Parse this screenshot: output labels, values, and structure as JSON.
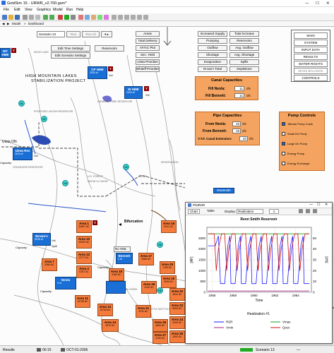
{
  "window": {
    "title": "GoldSim 15 - URWR_v2.700.gsm*",
    "min": "—",
    "max": "☐",
    "close": "✕"
  },
  "menu": [
    "File",
    "Edit",
    "View",
    "Graphics",
    "Model",
    "Run",
    "Help"
  ],
  "nav": {
    "page": "10",
    "pager": "1 / 2004",
    "back": "◀",
    "fwd": "▶",
    "model": "Model",
    "sep": "»",
    "dashboard": "Dashboard"
  },
  "controls": {
    "scenario": "Scenario 13",
    "run": "Run",
    "run_all": "Run All",
    "edit_time": "Edit Time Settings",
    "edit_scenario": "Edit Scenario Settings",
    "reservoirs": "Reservoirs"
  },
  "nav_buttons": [
    "Areas",
    "Total Delivery",
    "AF/AC Plot",
    "Sec. Yield",
    "Uinta Priorities",
    "Whiteff Priorities"
  ],
  "grid_buttons": [
    [
      "Increased Supply",
      "Total Increase"
    ],
    [
      "Pumping",
      "Reservoirs"
    ],
    [
      "Outflow",
      "Avg. Outflow"
    ],
    [
      "Shortage",
      "Avg. Shortage"
    ],
    [
      "Evaporation",
      "Spills"
    ],
    [
      "M and I Total",
      "Depletions"
    ]
  ],
  "side_menu": [
    "MAIN",
    "SYSTEM",
    "INPUT DATA",
    "RESULTS",
    "WATER RIGHTS",
    "MASS BALANCE",
    "CONTROLS"
  ],
  "canal": {
    "title": "Canal Capacities",
    "fill_neola": "Fill Neola:",
    "fill_bennett": "Fill Bennett:",
    "v1": "11",
    "v2": "11",
    "unit": "cfs"
  },
  "pipe": {
    "title": "Pipe Capacities",
    "from_neola": "From Neola:",
    "from_bennett": "From Bennett:",
    "ytf": "Y.T.F. Canal Extension:",
    "v1": "15",
    "v2": "15",
    "v3": "20",
    "unit": "cfs"
  },
  "pump": {
    "title": "Pump Controls",
    "items": [
      "Tabular Pump Costs",
      "Small Dir Pump",
      "Large Dir Pump",
      "Energy Pump",
      "Energy Exchange"
    ],
    "checked": [
      true,
      false,
      true,
      false,
      false
    ]
  },
  "map": {
    "title1": "HIGH MOUNTAIN LAKES",
    "title2": "STABILIZATION PROJECT",
    "bifurcation": "Bifurcation",
    "mapnotes": [
      "PROPOSED UINTAH RESERVOIR",
      "CEDARVIEW RESERVOIR",
      "PARADISE PARK RESERVOIR",
      "U.S. FOREST",
      "UINTAH & OURAY",
      "INDIAN",
      "RESERVATION",
      "MOON LAKE",
      "FARM CREEK",
      "LITTLE BOTTLE RESERVOIR",
      "WHITEROCKS RIVER"
    ]
  },
  "reservoirs": [
    {
      "name": "MT HME",
      "v": "",
      "sub": ""
    },
    {
      "name": "CP HME",
      "v": "Vol",
      "sub": "2034 af"
    },
    {
      "name": "W HME",
      "v": "Vol",
      "sub": "2034 af"
    },
    {
      "name": "Uinta Res",
      "v": "Vol",
      "sub": "1100 af"
    },
    {
      "name": "Brown's",
      "v": "Vol",
      "sub": "5035 af"
    },
    {
      "name": "Bennett",
      "v": "",
      "sub": "2 af"
    },
    {
      "name": "Neola",
      "v": "",
      "sub": "0 af"
    },
    {
      "name": "Montes",
      "v": "",
      "sub": ""
    }
  ],
  "areas": [
    {
      "name": "Area 1",
      "a": "12807 AC"
    },
    {
      "name": "Area 10",
      "a": "10002 AC"
    },
    {
      "name": "Area 12",
      "a": "5777 AC"
    },
    {
      "name": "Area 4",
      "a": "5787 AC"
    },
    {
      "name": "Area 7",
      "a": "2086 AC"
    },
    {
      "name": "Area 16",
      "a": "5011 AC"
    },
    {
      "name": "Area 17",
      "a": "2966 AC"
    },
    {
      "name": "Area 20",
      "a": "7150 AC"
    },
    {
      "name": "Area 15",
      "a": "4180 AC"
    },
    {
      "name": "Area 18",
      "a": "2240 AC"
    },
    {
      "name": "Area 19",
      "a": "2049 AC"
    },
    {
      "name": "Area 11",
      "a": "10736 AC"
    },
    {
      "name": "Area 13",
      "a": "10736 AC"
    },
    {
      "name": "Area 14",
      "a": "4570 AC"
    },
    {
      "name": "Area 21",
      "a": "4211 AC"
    },
    {
      "name": "Area 22",
      "a": "3811 AC"
    },
    {
      "name": "Area 23",
      "a": "5000 AC"
    },
    {
      "name": "Area 24",
      "a": "2000 AC"
    },
    {
      "name": "Area 25",
      "a": "1000 AC"
    },
    {
      "name": "Area 26",
      "a": "4800 AC"
    },
    {
      "name": "Area 27",
      "a": "3750 AC"
    }
  ],
  "nodes": [
    "N1",
    "N2",
    "N3",
    "N4",
    "N5",
    "N6"
  ],
  "labels": {
    "capacity": "Capacity:",
    "uinta_on": "Uinta ON",
    "nohml": "No HML",
    "resSmith": "ResSmith",
    "spill": "Spill"
  },
  "chart_window": {
    "title": "PlotRSR",
    "tab_chart": "Chart",
    "tab_table": "Table",
    "display_label": "Display:",
    "display_value": "Realization",
    "page": "1"
  },
  "chart_data": {
    "type": "line",
    "title": "Renn Smith Reservoir",
    "xlabel": "Time",
    "ylabel": "[AF]",
    "y2label": "[cfs]",
    "xticks": [
      "1956",
      "1958",
      "1960",
      "1962",
      "1964"
    ],
    "xlim": [
      1955.5,
      1965.5
    ],
    "ylim": [
      0,
      3000
    ],
    "yticks": [
      "0",
      "500",
      "1000",
      "1500",
      "2000",
      "2500"
    ],
    "y2lim": [
      0,
      60
    ],
    "y2ticks": [
      "0",
      "10",
      "20",
      "30",
      "40",
      "50"
    ],
    "legend_title": "Realization #1",
    "series": [
      {
        "name": "RSR",
        "color": "#1a1aff",
        "axis": "left",
        "x": [
          1955.6,
          1956.3,
          1956.6,
          1956.8,
          1957.2,
          1957.5,
          1957.7,
          1957.8,
          1958.2,
          1958.5,
          1958.7,
          1958.8,
          1959.2,
          1959.5,
          1959.7,
          1959.8,
          1960.2,
          1960.5,
          1960.7,
          1960.8,
          1961.2,
          1961.5,
          1961.7,
          1961.8,
          1962.2,
          1962.5,
          1962.7,
          1962.8,
          1963.2,
          1963.5,
          1963.7,
          1963.8,
          1964.2,
          1964.5,
          1964.7,
          1964.8,
          1965.3
        ],
        "y": [
          2150,
          2150,
          2600,
          400,
          400,
          2150,
          2600,
          400,
          400,
          2150,
          2600,
          400,
          400,
          2150,
          2600,
          400,
          400,
          2150,
          2600,
          400,
          400,
          2150,
          2600,
          400,
          400,
          2150,
          2600,
          400,
          400,
          2150,
          2600,
          400,
          400,
          2150,
          2600,
          400,
          400
        ]
      },
      {
        "name": "Vmax",
        "color": "#1a9e1a",
        "axis": "left",
        "x": [
          1955.6,
          1965.3
        ],
        "y": [
          2700,
          2700
        ]
      },
      {
        "name": "Vmin",
        "color": "#a02080",
        "axis": "left",
        "x": [
          1955.6,
          1965.3
        ],
        "y": [
          60,
          60
        ]
      },
      {
        "name": "Qout",
        "color": "#d01010",
        "axis": "right",
        "x": [
          1955.6,
          1956.2,
          1956.4,
          1956.6,
          1956.9,
          1957.2,
          1957.4,
          1957.6,
          1957.9,
          1958.2,
          1958.4,
          1958.6,
          1958.9,
          1959.2,
          1959.4,
          1959.6,
          1959.9,
          1960.2,
          1960.4,
          1960.6,
          1960.9,
          1961.2,
          1961.4,
          1961.6,
          1961.9,
          1962.2,
          1962.4,
          1962.6,
          1962.9,
          1963.2,
          1963.4,
          1963.6,
          1963.9,
          1964.2,
          1964.4,
          1964.6,
          1964.9,
          1965.3
        ],
        "y": [
          54,
          54,
          20,
          40,
          54,
          54,
          20,
          40,
          54,
          54,
          20,
          40,
          54,
          54,
          20,
          40,
          54,
          54,
          20,
          40,
          54,
          54,
          20,
          40,
          54,
          54,
          20,
          40,
          54,
          54,
          20,
          40,
          54,
          54,
          20,
          40,
          54,
          54
        ]
      }
    ]
  },
  "status": {
    "results": "Results",
    "time": "00:15",
    "date": "OCT-01-2006",
    "scenario": "Scenario 13",
    "hint": "—"
  }
}
